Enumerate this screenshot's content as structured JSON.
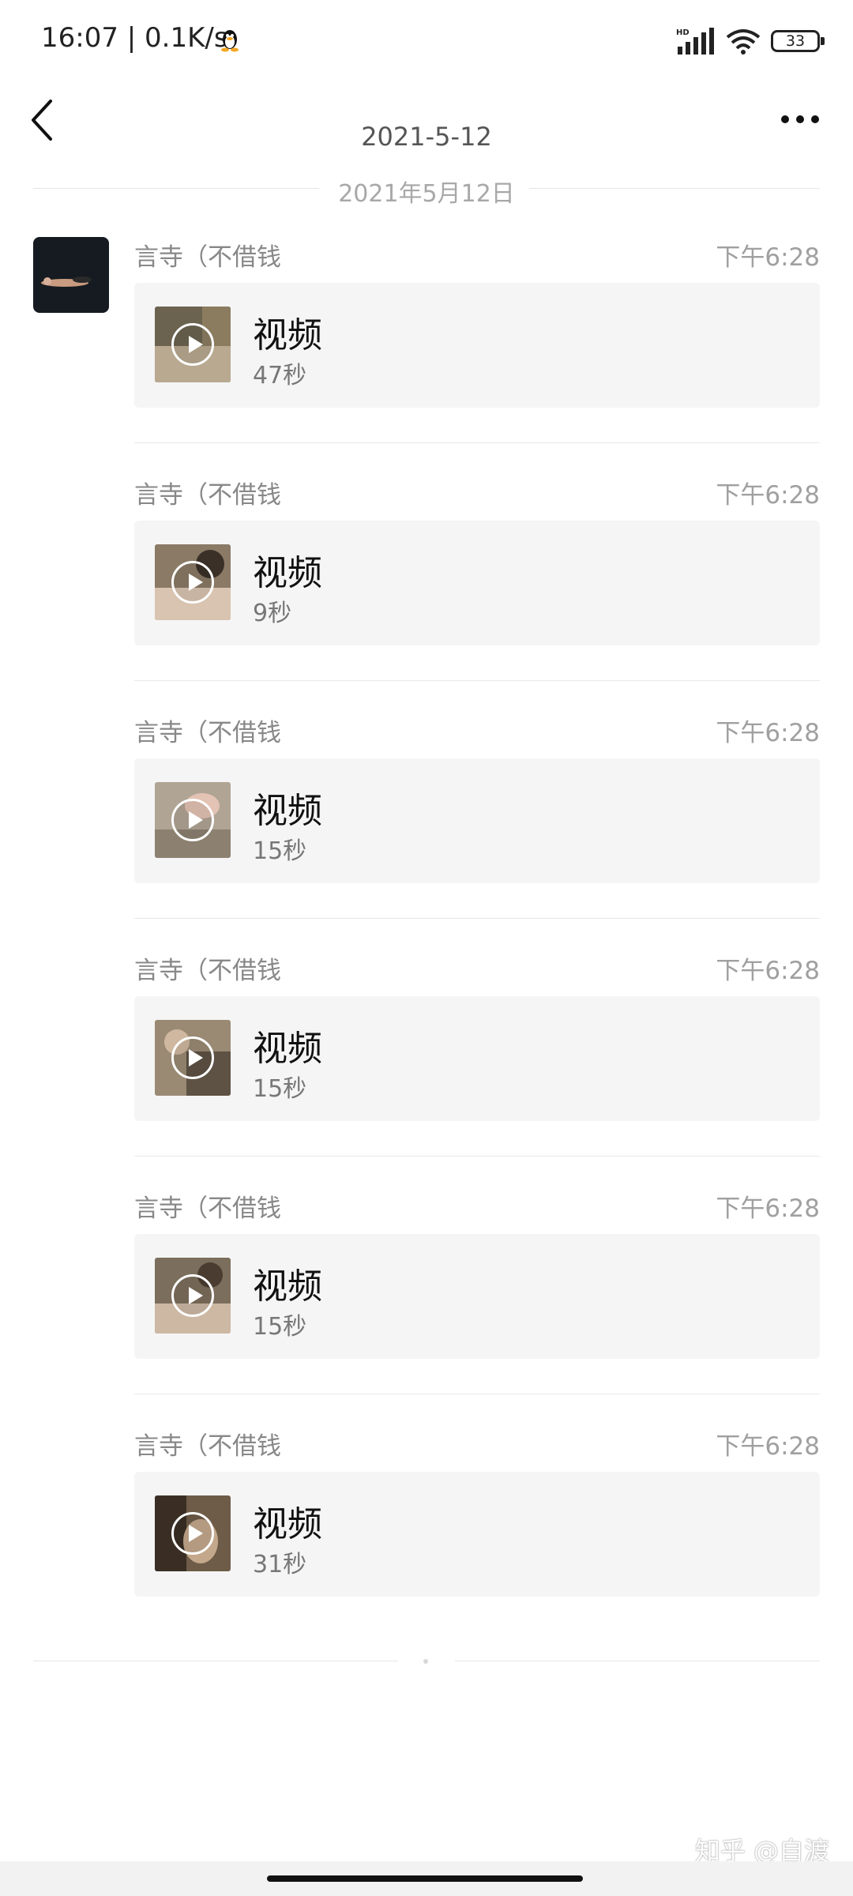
{
  "status_bar": {
    "time": "16:07 | 0.1K/s",
    "battery": "33",
    "signal_label": "HD"
  },
  "header": {
    "title": "2021-5-12"
  },
  "date_separator": "2021年5月12日",
  "messages": [
    {
      "sender": "言寺（不借钱",
      "time": "下午6:28",
      "label": "视频",
      "duration": "47秒"
    },
    {
      "sender": "言寺（不借钱",
      "time": "下午6:28",
      "label": "视频",
      "duration": "9秒"
    },
    {
      "sender": "言寺（不借钱",
      "time": "下午6:28",
      "label": "视频",
      "duration": "15秒"
    },
    {
      "sender": "言寺（不借钱",
      "time": "下午6:28",
      "label": "视频",
      "duration": "15秒"
    },
    {
      "sender": "言寺（不借钱",
      "time": "下午6:28",
      "label": "视频",
      "duration": "15秒"
    },
    {
      "sender": "言寺（不借钱",
      "time": "下午6:28",
      "label": "视频",
      "duration": "31秒"
    }
  ],
  "watermark": "知乎 @自渡"
}
